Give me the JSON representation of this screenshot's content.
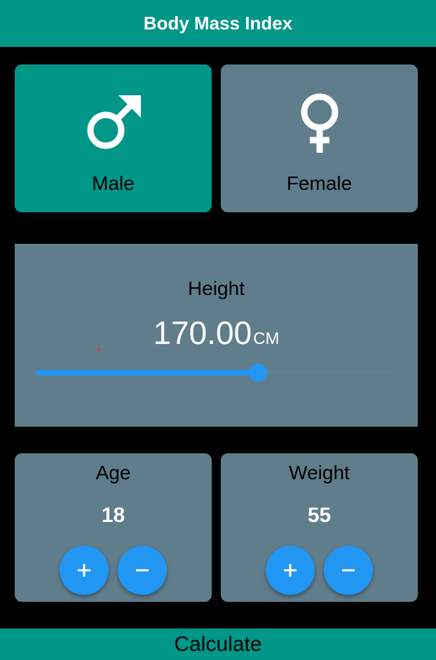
{
  "appbar": {
    "title": "Body Mass Index"
  },
  "gender": {
    "male": {
      "label": "Male",
      "icon": "male-symbol-icon",
      "selected": true
    },
    "female": {
      "label": "Female",
      "icon": "female-symbol-icon",
      "selected": false
    }
  },
  "height": {
    "title": "Height",
    "value": "170.00",
    "unit": "CM",
    "slider_fraction": 0.615
  },
  "age": {
    "title": "Age",
    "value": "18",
    "plus_icon": "plus-icon",
    "minus_icon": "minus-icon"
  },
  "weight": {
    "title": "Weight",
    "value": "55",
    "plus_icon": "plus-icon",
    "minus_icon": "minus-icon"
  },
  "calculate": {
    "label": "Calculate"
  },
  "colors": {
    "primary": "#009688",
    "card": "#607d8b",
    "accent": "#2196f3",
    "background": "#000000"
  }
}
